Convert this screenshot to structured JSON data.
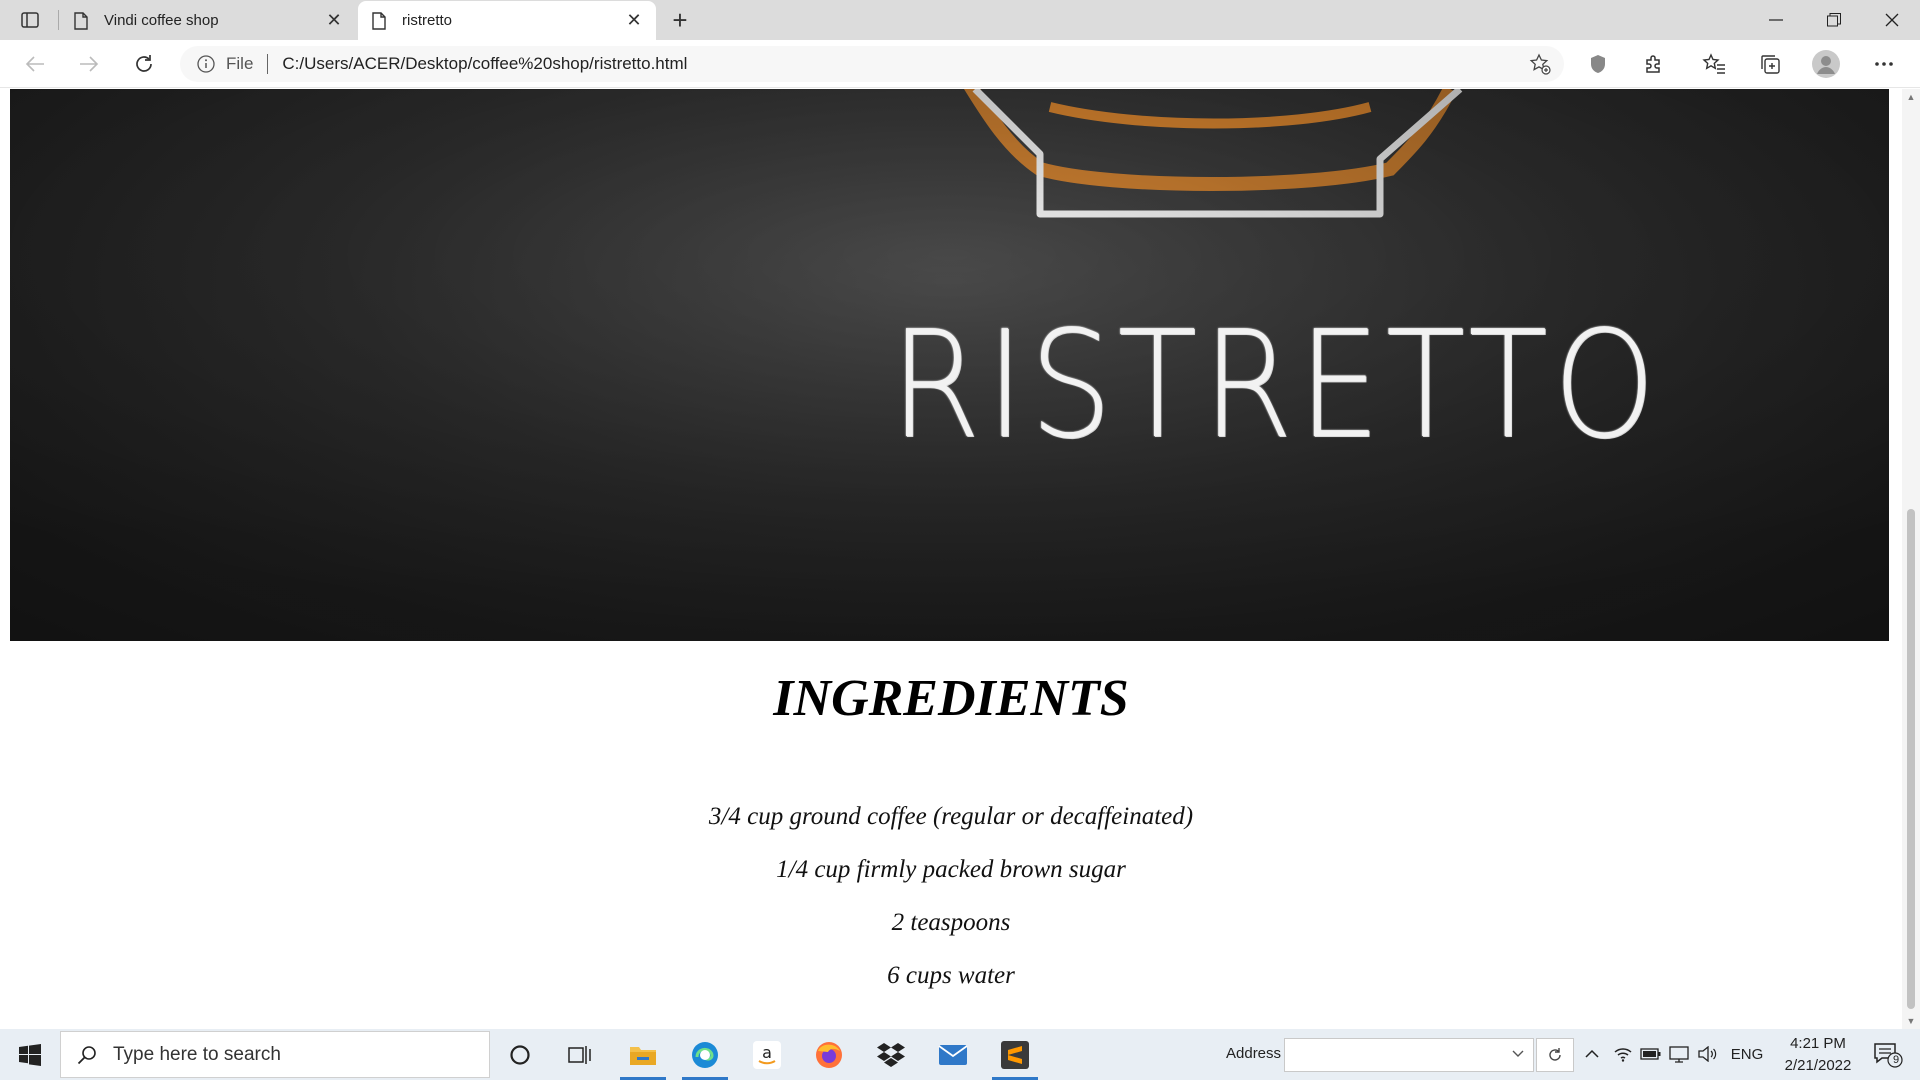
{
  "browser": {
    "tabs": [
      {
        "title": "Vindi coffee shop",
        "active": false
      },
      {
        "title": "ristretto",
        "active": true
      }
    ],
    "address": {
      "scheme": "File",
      "url": "C:/Users/ACER/Desktop/coffee%20shop/ristretto.html"
    }
  },
  "page": {
    "hero_text": "RISTRETTO",
    "heading": "INGREDIENTS",
    "ingredients": [
      "3/4 cup ground coffee (regular or decaffeinated)",
      "1/4 cup firmly packed brown sugar",
      "2 teaspoons",
      "6 cups water"
    ]
  },
  "taskbar": {
    "search_placeholder": "Type here to search",
    "address_label": "Address",
    "language": "ENG",
    "time": "4:21 PM",
    "date": "2/21/2022",
    "notification_count": "9"
  },
  "colors": {
    "accent": "#2f78c8",
    "hero_bg": "#2a2a2a",
    "chalk_orange": "#d9852f"
  }
}
